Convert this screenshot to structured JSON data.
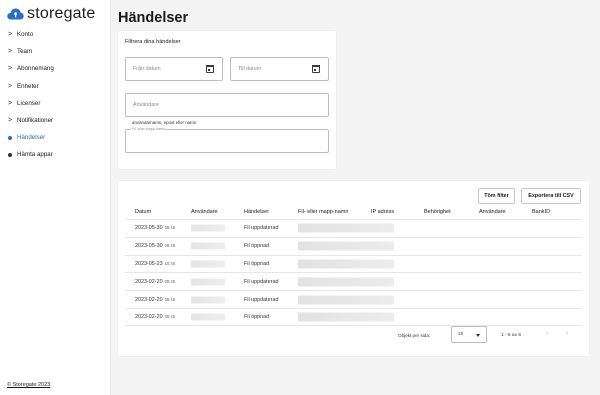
{
  "app": {
    "brand": "storegate",
    "brand_color": "#2b6cc4",
    "logo_icon": "cloud-keyhole-icon"
  },
  "sidebar": {
    "items": [
      {
        "label": "Konto",
        "icon": "chevron-right-icon"
      },
      {
        "label": "Team",
        "icon": "chevron-right-icon"
      },
      {
        "label": "Abonnemang",
        "icon": "chevron-right-icon"
      },
      {
        "label": "Enheter",
        "icon": "chevron-right-icon"
      },
      {
        "label": "Licenser",
        "icon": "chevron-right-icon"
      },
      {
        "label": "Notifikationer",
        "icon": "chevron-right-icon"
      },
      {
        "label": "Händelser",
        "icon": "dot-icon",
        "active": true
      },
      {
        "label": "Hämta appar",
        "icon": "dot-icon"
      }
    ],
    "footer": "© Storegate 2023"
  },
  "page": {
    "title": "Händelser"
  },
  "filters": {
    "heading": "Filtrera dina händelser",
    "date_from_placeholder": "Från datum",
    "date_to_placeholder": "Till datum",
    "user_placeholder": "Användare",
    "user_helper": "användarnamn, epost eller namn",
    "file_label": "Fil- eller mapp-namn"
  },
  "table": {
    "clear_button": "Töm filter",
    "export_button": "Exportera till CSV",
    "columns": [
      "Datum",
      "Användare",
      "Händelser",
      "Fil- eller mapp-namn",
      "IP adress",
      "Behörighet",
      "Användare",
      "BankID"
    ],
    "rows": [
      {
        "date": "2023-05-30",
        "time": "08:48",
        "event": "Fil uppdaterad"
      },
      {
        "date": "2023-05-30",
        "time": "08:48",
        "event": "Fil öppnad"
      },
      {
        "date": "2023-05-23",
        "time": "10:46",
        "event": "Fil öppnad"
      },
      {
        "date": "2023-02-20",
        "time": "08:48",
        "event": "Fil uppdaterad"
      },
      {
        "date": "2023-02-20",
        "time": "08:48",
        "event": "Fil uppdaterad"
      },
      {
        "date": "2023-02-20",
        "time": "08:46",
        "event": "Fil öppnad"
      }
    ],
    "pagination": {
      "rows_per_page_label": "Objekt per sida:",
      "rows_per_page_value": "25",
      "range": "1 - 6 av 6"
    }
  }
}
